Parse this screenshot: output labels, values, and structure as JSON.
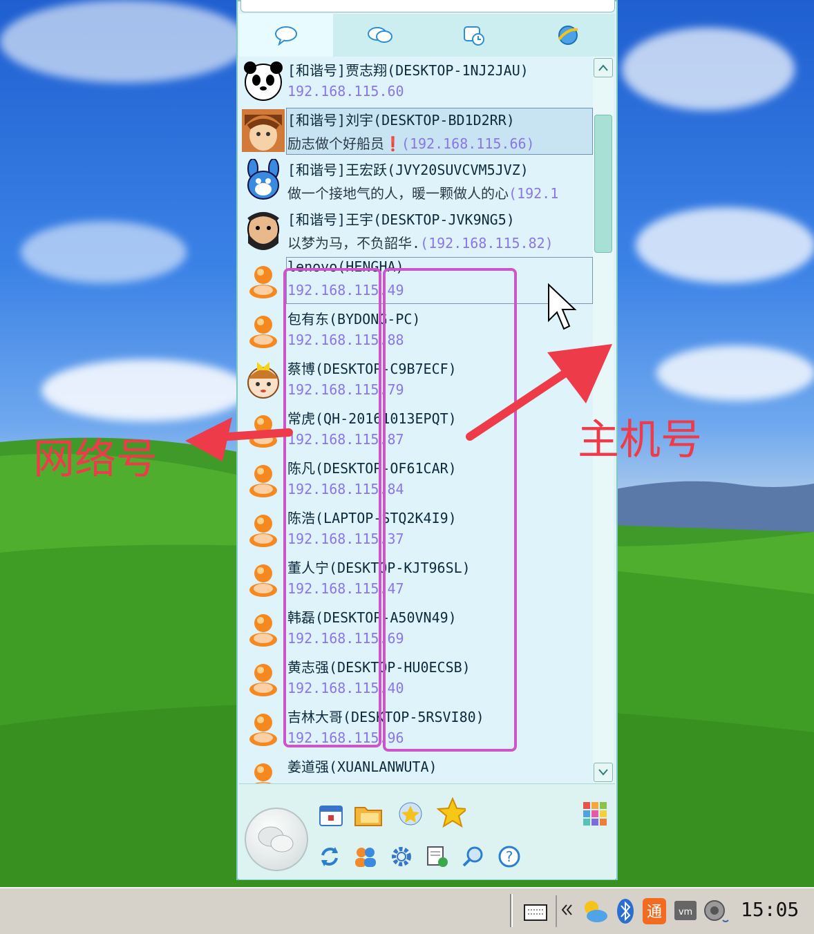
{
  "tabs": [
    "chat-icon",
    "group-chat-icon",
    "recent-icon",
    "web-icon"
  ],
  "contacts": [
    {
      "name": "[和谐号]贾志翔(DESKTOP-1NJ2JAU)",
      "sub": "",
      "ip": "192.168.115.60",
      "avatar": "panda-avatar"
    },
    {
      "name": "[和谐号]刘宇(DESKTOP-BD1D2RR)",
      "sub": "励志做个好船员❗",
      "ip": "(192.168.115.66)",
      "avatar": "boy-avatar"
    },
    {
      "name": "[和谐号]王宏跃(JVY20SUVCVM5JVZ)",
      "sub": "做一个接地气的人，暖一颗做人的心",
      "ip": "(192.1",
      "avatar": "rabbit-avatar"
    },
    {
      "name": "[和谐号]王宇(DESKTOP-JVK9NG5)",
      "sub": "以梦为马，不负韶华.",
      "ip": "(192.168.115.82)",
      "avatar": "bearded-avatar"
    },
    {
      "name": "lenovo(HENGHA)",
      "sub": "",
      "ip": "192.168.115.49",
      "avatar": "default-avatar"
    },
    {
      "name": "包有东(BYDONG-PC)",
      "sub": "",
      "ip": "192.168.115.88",
      "avatar": "default-avatar"
    },
    {
      "name": "蔡博(DESKTOP-C9B7ECF)",
      "sub": "",
      "ip": "192.168.115.79",
      "avatar": "girl-avatar"
    },
    {
      "name": "常虎(QH-20161013EPQT)",
      "sub": "",
      "ip": "192.168.115.87",
      "avatar": "default-avatar"
    },
    {
      "name": "陈凡(DESKTOP-OF61CAR)",
      "sub": "",
      "ip": "192.168.115.84",
      "avatar": "default-avatar"
    },
    {
      "name": "陈浩(LAPTOP-STQ2K4I9)",
      "sub": "",
      "ip": "192.168.115.37",
      "avatar": "default-avatar"
    },
    {
      "name": "董人宁(DESKTOP-KJT96SL)",
      "sub": "",
      "ip": "192.168.115.47",
      "avatar": "default-avatar"
    },
    {
      "name": "韩磊(DESKTOP-A50VN49)",
      "sub": "",
      "ip": "192.168.115.69",
      "avatar": "default-avatar"
    },
    {
      "name": "黄志强(DESKTOP-HU0ECSB)",
      "sub": "",
      "ip": "192.168.115.40",
      "avatar": "default-avatar"
    },
    {
      "name": "吉林大哥(DESKTOP-5RSVI80)",
      "sub": "",
      "ip": "192.168.115.96",
      "avatar": "default-avatar"
    },
    {
      "name": "姜道强(XUANLANWUTA)",
      "sub": "",
      "ip": "",
      "avatar": "default-avatar"
    }
  ],
  "annotations": {
    "network_label": "网络号",
    "host_label": "主机号"
  },
  "clock": "15:05",
  "colors": {
    "annotation": "#ee3b4a",
    "box": "#cc55cc",
    "ip": "#8a76e6"
  }
}
